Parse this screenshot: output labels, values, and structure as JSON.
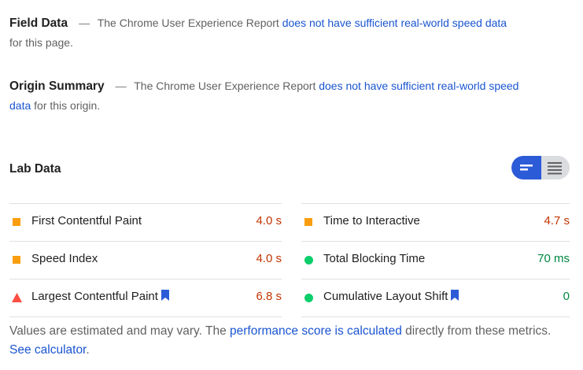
{
  "field": {
    "title": "Field Data",
    "dash": "—",
    "text_before": "The Chrome User Experience Report",
    "link": "does not have sufficient real-world speed data",
    "text_after": "for this page."
  },
  "origin": {
    "title": "Origin Summary",
    "dash": "—",
    "text_before": "The Chrome User Experience Report",
    "link": "does not have sufficient real-world speed data",
    "text_after": "for this origin."
  },
  "lab": {
    "title": "Lab Data",
    "toggle_icons": [
      "bar-view-icon",
      "list-view-icon"
    ],
    "metrics_left": [
      {
        "label": "First Contentful Paint",
        "value": "4.0 s",
        "status": "average"
      },
      {
        "label": "Speed Index",
        "value": "4.0 s",
        "status": "average"
      },
      {
        "label": "Largest Contentful Paint",
        "value": "6.8 s",
        "status": "fail",
        "bookmark": true
      }
    ],
    "metrics_right": [
      {
        "label": "Time to Interactive",
        "value": "4.7 s",
        "status": "average"
      },
      {
        "label": "Total Blocking Time",
        "value": "70 ms",
        "status": "pass"
      },
      {
        "label": "Cumulative Layout Shift",
        "value": "0",
        "status": "pass",
        "bookmark": true
      }
    ],
    "colors": {
      "average": "#fa9e0f",
      "pass": "#0cce6b",
      "fail": "#ff4e42",
      "value_fail": "#c33300",
      "value_pass": "#018642"
    }
  },
  "footer": {
    "text1": "Values are estimated and may vary. The",
    "link1": "performance score is calculated",
    "text2": "directly from these metrics.",
    "link2": "See calculator",
    "text3": "."
  }
}
